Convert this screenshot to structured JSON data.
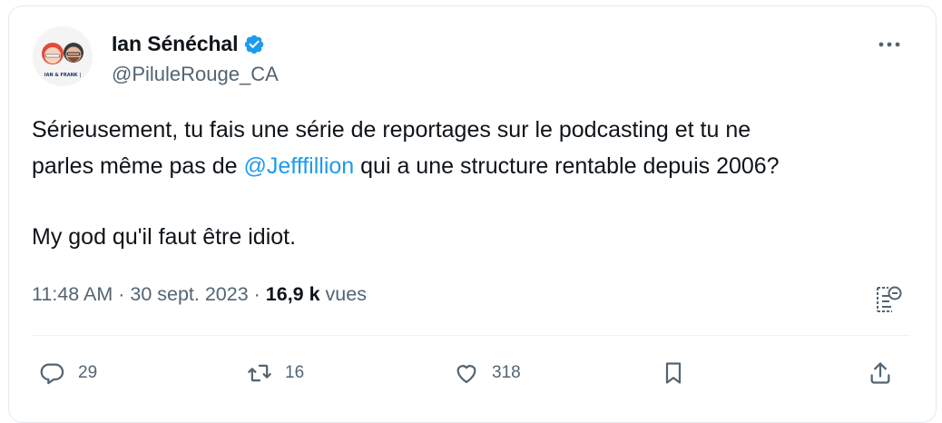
{
  "author": {
    "display_name": "Ian Sénéchal",
    "handle": "@PiluleRouge_CA",
    "avatar_caption": "IAN & FRANK |",
    "verified_color": "#1d9bf0"
  },
  "tweet": {
    "line1": "Sérieusement, tu fais une série de reportages sur le podcasting et tu ne",
    "line2_before": "parles même pas de ",
    "mention": "@Jefffillion",
    "line2_after": " qui a une structure rentable depuis 2006?",
    "paragraph2": "My god qu'il faut être idiot."
  },
  "meta": {
    "time": "11:48 AM",
    "separator1": " · ",
    "date": "30 sept. 2023",
    "separator2": " · ",
    "views_count": "16,9 k",
    "views_label": " vues"
  },
  "actions": {
    "reply_count": "29",
    "retweet_count": "16",
    "like_count": "318"
  },
  "icons": {
    "more": "more-dots-icon",
    "verified": "verified-badge-icon",
    "analytics": "analytics-icon",
    "reply": "reply-icon",
    "retweet": "retweet-icon",
    "like": "heart-icon",
    "bookmark": "bookmark-icon",
    "share": "share-icon"
  },
  "colors": {
    "text": "#0f1419",
    "secondary": "#536471",
    "accent": "#1d9bf0",
    "border": "#e6e9ec"
  }
}
